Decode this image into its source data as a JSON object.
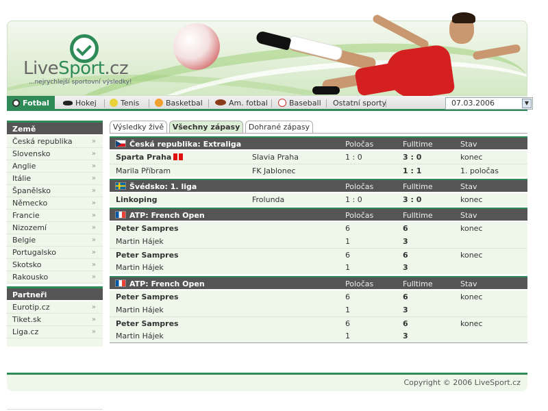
{
  "header": {
    "logo_part1": "Live",
    "logo_part2": "Sport",
    "logo_part3": ".cz",
    "slogan": "...nejrychlejší sportovní výsledky!"
  },
  "nav": {
    "items": [
      {
        "label": "Fotbal",
        "icon": "soccer-ball-icon",
        "active": true
      },
      {
        "label": "Hokej",
        "icon": "hockey-puck-icon"
      },
      {
        "label": "Tenis",
        "icon": "tennis-ball-icon"
      },
      {
        "label": "Basketbal",
        "icon": "basketball-icon"
      },
      {
        "label": "Am. fotbal",
        "icon": "american-football-icon"
      },
      {
        "label": "Baseball",
        "icon": "baseball-icon"
      },
      {
        "label": "Ostatní sporty"
      }
    ],
    "date_value": "07.03.2006"
  },
  "sidebar": {
    "countries_title": "Země",
    "countries": [
      "Česká republika",
      "Slovensko",
      "Anglie",
      "Itálie",
      "Španělsko",
      "Německo",
      "Francie",
      "Nizozemí",
      "Belgie",
      "Portugalsko",
      "Skotsko",
      "Rakousko"
    ],
    "partners_title": "Partneři",
    "partners": [
      "Eurotip.cz",
      "Tiket.sk",
      "Liga.cz"
    ],
    "chevron": "»"
  },
  "tabs": [
    "Výsledky živě",
    "Všechny zápasy",
    "Dohrané zápasy"
  ],
  "columns": {
    "half": "Poločas",
    "full": "Fulltime",
    "status": "Stav"
  },
  "groups": [
    {
      "title": "Česká republika: Extraliga",
      "flag": "cz",
      "rows": [
        {
          "home": "Sparta Praha",
          "away": "Slavia Praha",
          "half": "1 : 0",
          "full": "3 : 0",
          "status": "konec"
        },
        {
          "home": "Marila Příbram",
          "away": "FK Jablonec",
          "half": "",
          "full": "1 : 1",
          "status": "1. poločas"
        }
      ]
    },
    {
      "title": "Švédsko: 1. liga",
      "flag": "se",
      "rows": [
        {
          "home": "Linkoping",
          "away": "Frolunda",
          "half": "1 : 0",
          "full": "3 : 0",
          "status": "konec"
        }
      ]
    },
    {
      "title": "ATP: French Open",
      "flag": "fr",
      "rows": [
        {
          "home": "Peter Sampres",
          "half": "6",
          "full": "6",
          "status": "konec"
        },
        {
          "home": "Martin Hájek",
          "half": "1",
          "full": "3",
          "status": ""
        },
        {
          "home": "Peter Sampres",
          "half": "6",
          "full": "6",
          "status": "konec"
        },
        {
          "home": "Martin Hájek",
          "half": "1",
          "full": "3",
          "status": ""
        }
      ]
    },
    {
      "title": "ATP: French Open",
      "flag": "fr",
      "rows": [
        {
          "home": "Peter Sampres",
          "half": "6",
          "full": "6",
          "status": "konec"
        },
        {
          "home": "Martin Hájek",
          "half": "1",
          "full": "3",
          "status": ""
        },
        {
          "home": "Peter Sampres",
          "half": "6",
          "full": "6",
          "status": "konec"
        },
        {
          "home": "Martin Hájek",
          "half": "1",
          "full": "3",
          "status": ""
        }
      ]
    }
  ],
  "footer": {
    "copyright": "Copyright © 2006 LiveSport.cz"
  },
  "colors": {
    "accent": "#2e8b57",
    "header_dark": "#555555",
    "row_bg": "#eef7ea",
    "red_card": "#e01010"
  }
}
